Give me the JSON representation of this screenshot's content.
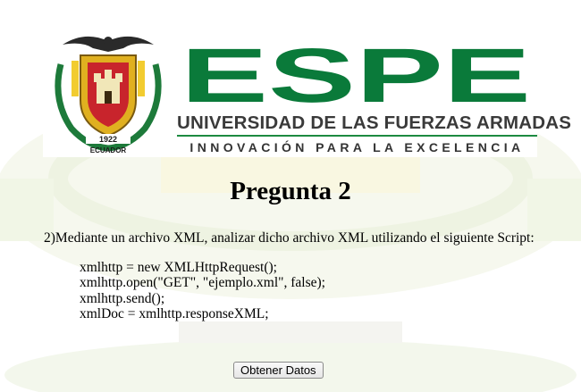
{
  "banner": {
    "wordmark": "ESPE",
    "university": "UNIVERSIDAD DE LAS FUERZAS ARMADAS",
    "tagline": "INNOVACIÓN PARA LA EXCELENCIA",
    "crest_year": "1922",
    "crest_country": "ECUADOR"
  },
  "page": {
    "title": "Pregunta 2",
    "question": "2)Mediante un archivo XML, analizar dicho archivo XML utilizando el siguiente Script:",
    "script_lines": [
      "xmlhttp = new XMLHttpRequest();",
      "xmlhttp.open(\"GET\", \"ejemplo.xml\", false);",
      "xmlhttp.send();",
      "xmlDoc = xmlhttp.responseXML;"
    ],
    "button_label": "Obtener Datos"
  },
  "colors": {
    "brand_green": "#0a7a3a",
    "rule_green": "#1d8a41",
    "crest_gold": "#e0b020",
    "crest_red": "#c8242c"
  }
}
